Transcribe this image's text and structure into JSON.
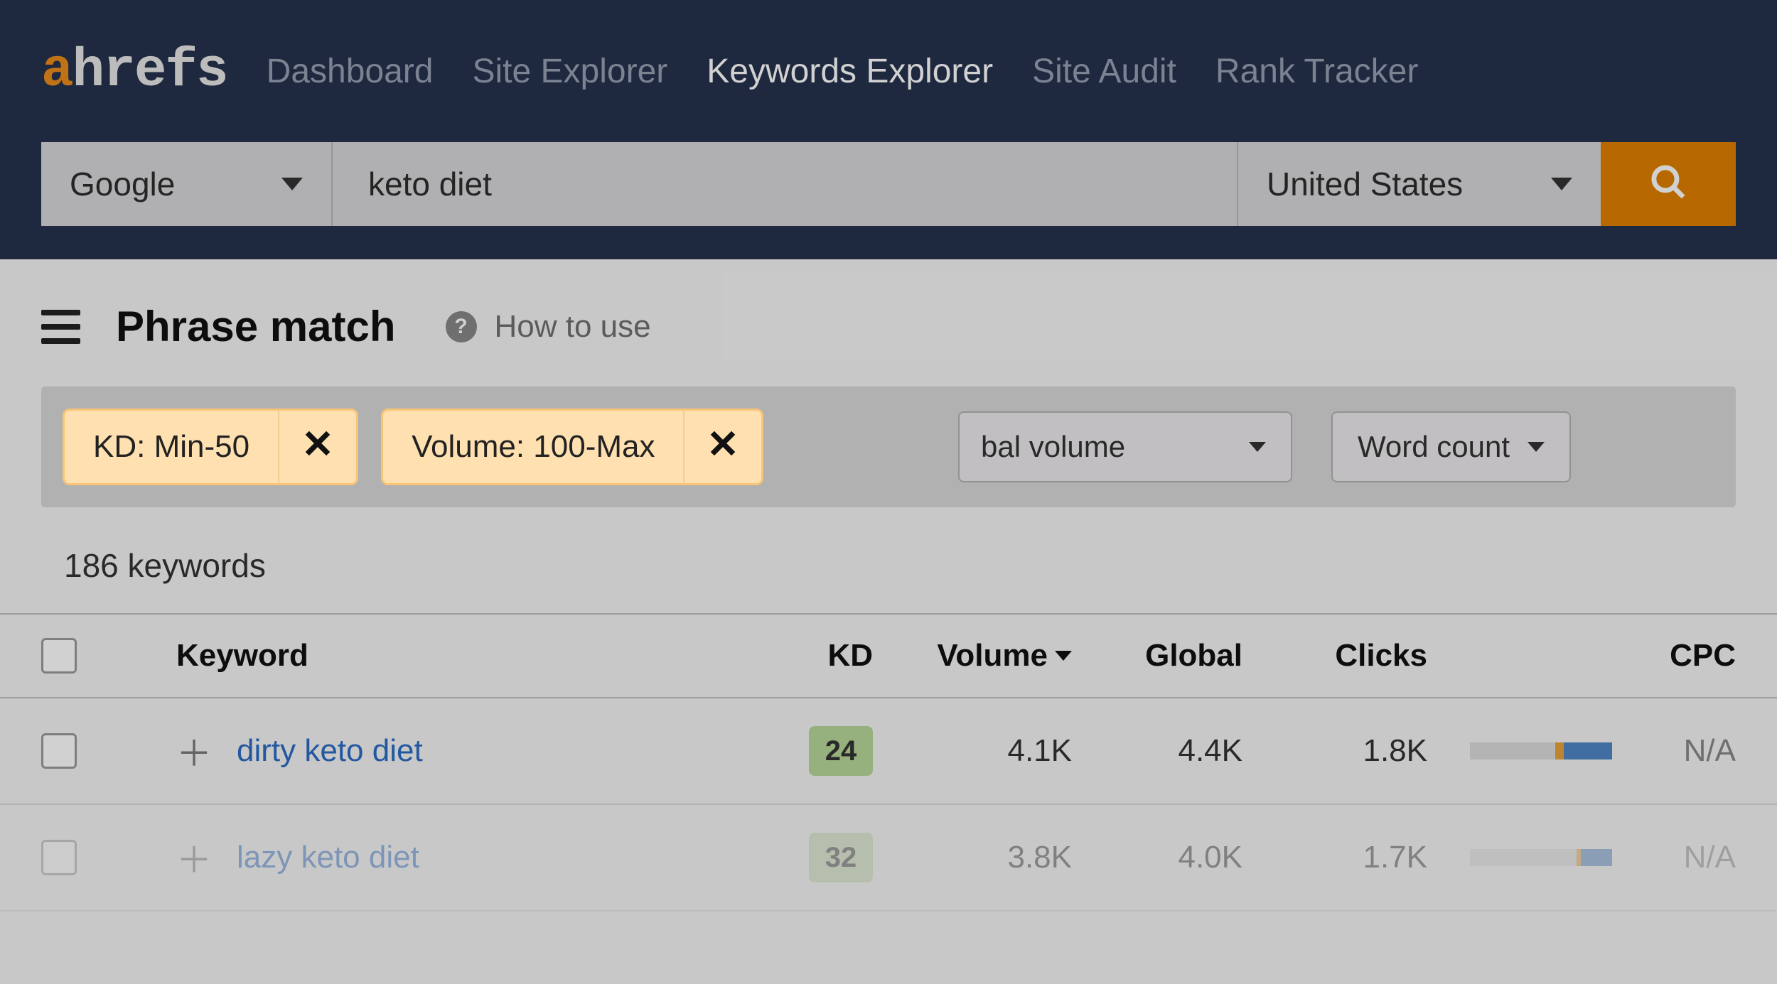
{
  "logo": {
    "a": "a",
    "rest": "hrefs"
  },
  "nav": {
    "dashboard": "Dashboard",
    "site_explorer": "Site Explorer",
    "keywords_explorer": "Keywords Explorer",
    "site_audit": "Site Audit",
    "rank_tracker": "Rank Tracker"
  },
  "search": {
    "engine": "Google",
    "keyword": "keto diet",
    "country": "United States"
  },
  "page": {
    "title": "Phrase match",
    "how_to_use": "How to use"
  },
  "filters": {
    "kd": "KD: Min-50",
    "volume": "Volume: 100-Max",
    "global_volume_partial": "bal volume",
    "word_count": "Word count"
  },
  "count": "186 keywords",
  "columns": {
    "keyword": "Keyword",
    "kd": "KD",
    "volume": "Volume",
    "global": "Global",
    "clicks": "Clicks",
    "cpc": "CPC"
  },
  "rows": [
    {
      "keyword": "dirty keto diet",
      "kd": "24",
      "volume": "4.1K",
      "global": "4.4K",
      "clicks": "1.8K",
      "cpc": "N/A"
    },
    {
      "keyword": "lazy keto diet",
      "kd": "32",
      "volume": "3.8K",
      "global": "4.0K",
      "clicks": "1.7K",
      "cpc": "N/A"
    }
  ]
}
